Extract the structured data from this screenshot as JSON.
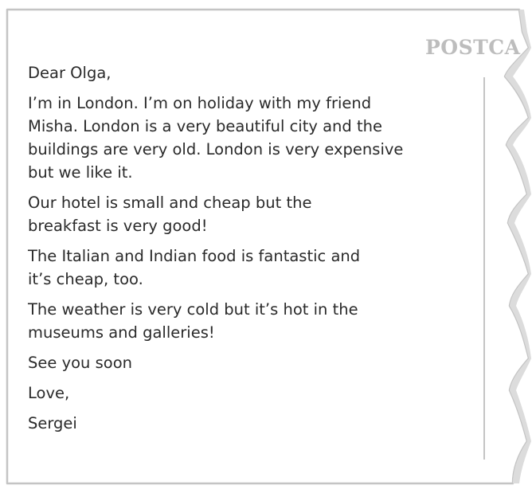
{
  "postcard": {
    "heading": "POSTCA",
    "letter": {
      "salutation": "Dear Olga,",
      "paragraphs": [
        {
          "lines": [
            "I’m in London. I’m on holiday with my friend",
            "Misha. London is a very beautiful city and the",
            "buildings are very old. London is very expensive",
            "but we like it."
          ]
        },
        {
          "lines": [
            "Our hotel is small and cheap but the",
            "breakfast is very good!"
          ]
        },
        {
          "lines": [
            "The Italian and Indian food is fantastic and",
            "it’s cheap, too."
          ]
        },
        {
          "lines": [
            "The weather is very cold but it’s hot in the",
            "museums and galleries!"
          ]
        }
      ],
      "closing": "See you soon",
      "signoff": "Love,",
      "signature": "Sergei"
    },
    "colors": {
      "border": "#c4c4c4",
      "heading": "#bdbdbd",
      "text": "#2a2a2a"
    }
  }
}
